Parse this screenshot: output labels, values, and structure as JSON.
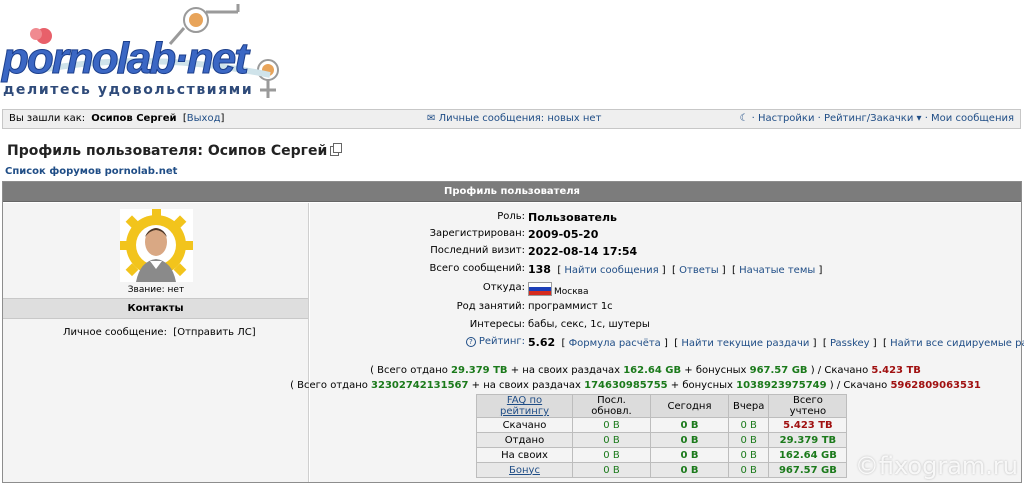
{
  "logo": {
    "text": "pornolab·net",
    "tagline": "делитесь удовольствиями"
  },
  "topbar": {
    "logged_as": "Вы зашли как:",
    "username": "Осипов Сергей",
    "logout": "Выход",
    "messages": "Личные сообщения: новых нет",
    "links": "· Настройки · Рейтинг/Закачки ▾ · Мои сообщения"
  },
  "page": {
    "title": "Профиль пользователя: Осипов Сергей",
    "forum_link": "Список форумов pornolab.net",
    "section_title": "Профиль пользователя"
  },
  "left": {
    "rank": "Звание: нет",
    "contacts_title": "Контакты",
    "pm_label": "Личное сообщение:",
    "pm_link": "Отправить ЛС"
  },
  "info": {
    "role_k": "Роль:",
    "role_v": "Пользователь",
    "reg_k": "Зарегистрирован:",
    "reg_v": "2009-05-20",
    "visit_k": "Последний визит:",
    "visit_v": "2022-08-14 17:54",
    "posts_k": "Всего сообщений:",
    "posts_v": "138",
    "find_posts": "Найти сообщения",
    "answers": "Ответы",
    "topics": "Начатые темы",
    "from_k": "Откуда:",
    "from_v": "Москва",
    "job_k": "Род занятий:",
    "job_v": "программист 1с",
    "interests_k": "Интересы:",
    "interests_v": "бабы, секс, 1с, шутеры",
    "rating_k": "Рейтинг:",
    "rating_v": "5.62",
    "formula": "Формула расчёта",
    "current": "Найти текущие раздачи",
    "passkey": "Passkey",
    "seeding": "Найти все сидируемые раздачи"
  },
  "totals": {
    "l1_a": "( Всего отдано ",
    "l1_b": "29.379 TB",
    "l1_c": " + на своих раздачах ",
    "l1_d": "162.64 GB",
    "l1_e": " + бонусных ",
    "l1_f": "967.57 GB",
    "l1_g": " ) / Скачано ",
    "l1_h": "5.423 TB",
    "l2_a": "( Всего отдано ",
    "l2_b": "32302742131567",
    "l2_c": " + на своих раздачах ",
    "l2_d": "174630985755",
    "l2_e": " + бонусных ",
    "l2_f": "1038923975749",
    "l2_g": " ) / Скачано ",
    "l2_h": "5962809063531"
  },
  "stats": {
    "headers": [
      "FAQ по рейтингу",
      "Посл. обновл.",
      "Сегодня",
      "Вчера",
      "Всего учтено"
    ],
    "rows": [
      [
        "Скачано",
        "0 B",
        "0 B",
        "0 B",
        "5.423 TB"
      ],
      [
        "Отдано",
        "0 B",
        "0 B",
        "0 B",
        "29.379 TB"
      ],
      [
        "На своих",
        "0 B",
        "0 B",
        "0 B",
        "162.64 GB"
      ],
      [
        "Бонус",
        "0 B",
        "0 B",
        "0 B",
        "967.57 GB"
      ]
    ]
  },
  "watermark": "©fixogram.ru"
}
